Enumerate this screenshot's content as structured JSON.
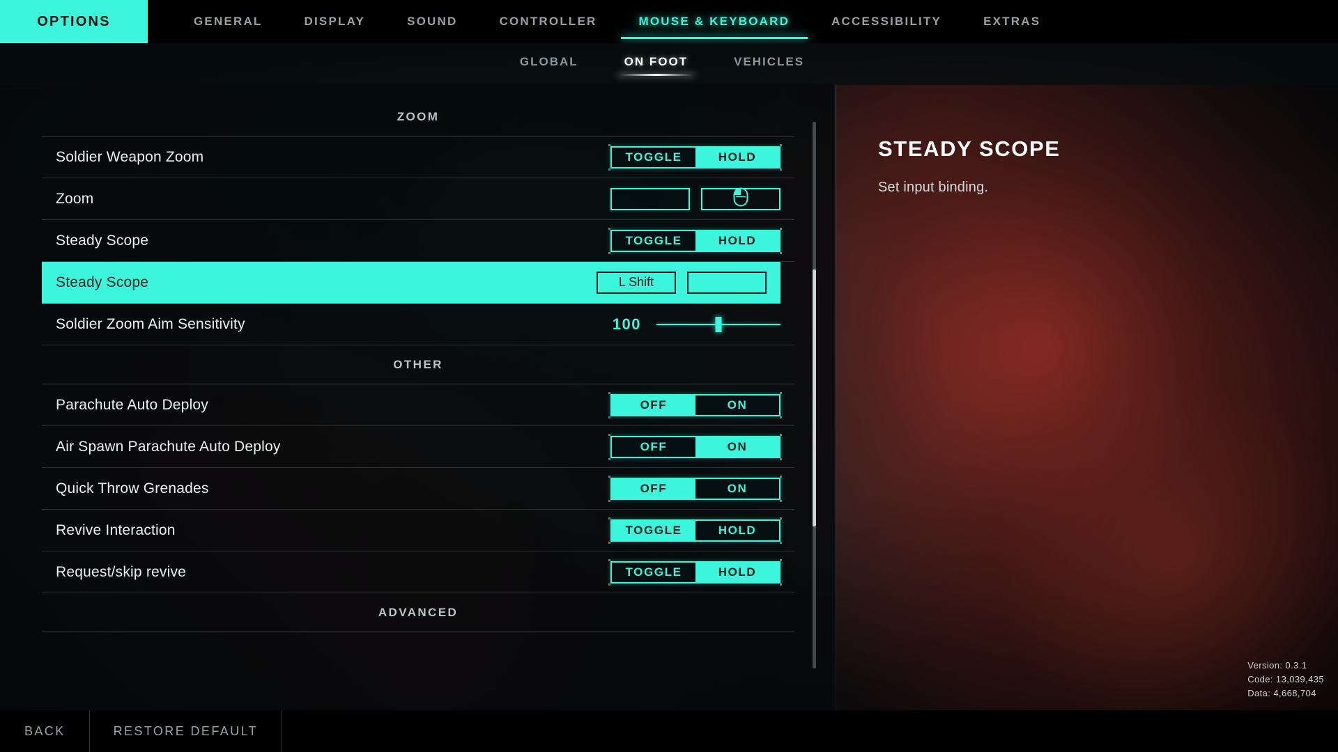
{
  "header": {
    "badge_label": "OPTIONS",
    "tabs": [
      {
        "label": "GENERAL",
        "active": false
      },
      {
        "label": "DISPLAY",
        "active": false
      },
      {
        "label": "SOUND",
        "active": false
      },
      {
        "label": "CONTROLLER",
        "active": false
      },
      {
        "label": "MOUSE & KEYBOARD",
        "active": true
      },
      {
        "label": "ACCESSIBILITY",
        "active": false
      },
      {
        "label": "EXTRAS",
        "active": false
      }
    ],
    "subtabs": [
      {
        "label": "GLOBAL",
        "active": false
      },
      {
        "label": "ON FOOT",
        "active": true
      },
      {
        "label": "VEHICLES",
        "active": false
      }
    ]
  },
  "settings": {
    "sections": [
      {
        "title": "ZOOM",
        "rows": [
          {
            "label": "Soldier Weapon Zoom",
            "type": "segmented",
            "options": [
              "TOGGLE",
              "HOLD"
            ],
            "selected": "HOLD",
            "highlighted": false
          },
          {
            "label": "Zoom",
            "type": "binding",
            "slots": [
              {
                "value": "",
                "icon": ""
              },
              {
                "value": "",
                "icon": "mouse-left-button-icon"
              }
            ],
            "highlighted": false
          },
          {
            "label": "Steady Scope",
            "type": "segmented",
            "options": [
              "TOGGLE",
              "HOLD"
            ],
            "selected": "HOLD",
            "highlighted": false
          },
          {
            "label": "Steady Scope",
            "type": "binding",
            "slots": [
              {
                "value": "L Shift",
                "icon": ""
              },
              {
                "value": "",
                "icon": ""
              }
            ],
            "highlighted": true
          },
          {
            "label": "Soldier Zoom Aim Sensitivity",
            "type": "slider",
            "value": "100",
            "percent": 50,
            "highlighted": false
          }
        ]
      },
      {
        "title": "OTHER",
        "rows": [
          {
            "label": "Parachute Auto Deploy",
            "type": "segmented",
            "options": [
              "OFF",
              "ON"
            ],
            "selected": "OFF",
            "highlighted": false
          },
          {
            "label": "Air Spawn Parachute Auto Deploy",
            "type": "segmented",
            "options": [
              "OFF",
              "ON"
            ],
            "selected": "ON",
            "highlighted": false
          },
          {
            "label": "Quick Throw Grenades",
            "type": "segmented",
            "options": [
              "OFF",
              "ON"
            ],
            "selected": "OFF",
            "highlighted": false
          },
          {
            "label": "Revive Interaction",
            "type": "segmented",
            "options": [
              "TOGGLE",
              "HOLD"
            ],
            "selected": "TOGGLE",
            "highlighted": false
          },
          {
            "label": "Request/skip revive",
            "type": "segmented",
            "options": [
              "TOGGLE",
              "HOLD"
            ],
            "selected": "HOLD",
            "highlighted": false
          }
        ]
      },
      {
        "title": "ADVANCED",
        "rows": []
      }
    ]
  },
  "scrollbar": {
    "thumb_top_percent": 27,
    "thumb_height_percent": 47
  },
  "detail": {
    "title": "STEADY SCOPE",
    "description": "Set input binding."
  },
  "version_info": {
    "version": "Version: 0.3.1",
    "code": "Code: 13,039,435",
    "data": "Data: 4,668,704"
  },
  "footer": {
    "buttons": [
      {
        "label": "BACK"
      },
      {
        "label": "RESTORE DEFAULT"
      }
    ]
  },
  "colors": {
    "accent": "#3cf5dc",
    "bg": "#05090b",
    "text": "#e9f2f4"
  }
}
